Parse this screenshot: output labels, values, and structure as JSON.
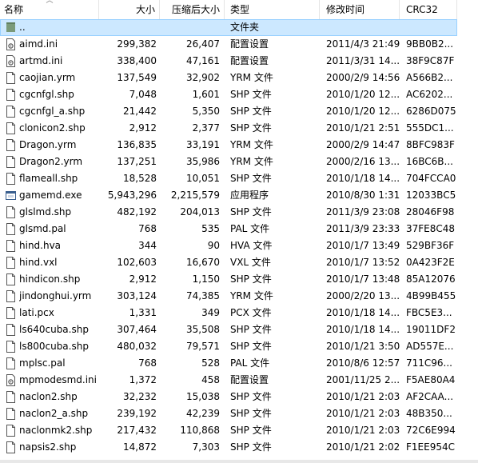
{
  "columns": {
    "name": "名称",
    "size": "大小",
    "packed": "压缩后大小",
    "type": "类型",
    "modified": "修改时间",
    "crc": "CRC32"
  },
  "selected_row": {
    "name": "..",
    "type": "文件夹"
  },
  "files": [
    {
      "name": "aimd.ini",
      "size": "299,382",
      "packed": "26,407",
      "type": "配置设置",
      "modified": "2011/4/3 21:49",
      "crc": "9BB0B2...",
      "icon": "ini-gear-icon"
    },
    {
      "name": "artmd.ini",
      "size": "338,400",
      "packed": "47,161",
      "type": "配置设置",
      "modified": "2011/3/31 14...",
      "crc": "38F9C87F",
      "icon": "ini-gear-icon"
    },
    {
      "name": "caojian.yrm",
      "size": "137,549",
      "packed": "32,902",
      "type": "YRM 文件",
      "modified": "2000/2/9 14:56",
      "crc": "A566B2...",
      "icon": "file-icon"
    },
    {
      "name": "cgcnfgl.shp",
      "size": "7,048",
      "packed": "1,601",
      "type": "SHP 文件",
      "modified": "2010/1/20 12...",
      "crc": "AC6202...",
      "icon": "file-icon"
    },
    {
      "name": "cgcnfgl_a.shp",
      "size": "21,442",
      "packed": "5,350",
      "type": "SHP 文件",
      "modified": "2010/1/20 12...",
      "crc": "6286D075",
      "icon": "file-icon"
    },
    {
      "name": "clonicon2.shp",
      "size": "2,912",
      "packed": "2,377",
      "type": "SHP 文件",
      "modified": "2010/1/21 2:51",
      "crc": "555DC1...",
      "icon": "file-icon"
    },
    {
      "name": "Dragon.yrm",
      "size": "136,835",
      "packed": "33,191",
      "type": "YRM 文件",
      "modified": "2000/2/9 14:47",
      "crc": "8BFC983F",
      "icon": "file-icon"
    },
    {
      "name": "Dragon2.yrm",
      "size": "137,251",
      "packed": "35,986",
      "type": "YRM 文件",
      "modified": "2000/2/16 13...",
      "crc": "16BC6B...",
      "icon": "file-icon"
    },
    {
      "name": "flameall.shp",
      "size": "18,528",
      "packed": "10,051",
      "type": "SHP 文件",
      "modified": "2010/1/18 14...",
      "crc": "704FCCA0",
      "icon": "file-icon"
    },
    {
      "name": "gamemd.exe",
      "size": "5,943,296",
      "packed": "2,215,579",
      "type": "应用程序",
      "modified": "2010/8/30 1:31",
      "crc": "12033BC5",
      "icon": "exe-window-icon"
    },
    {
      "name": "glslmd.shp",
      "size": "482,192",
      "packed": "204,013",
      "type": "SHP 文件",
      "modified": "2011/3/9 23:08",
      "crc": "28046F98",
      "icon": "file-icon"
    },
    {
      "name": "glsmd.pal",
      "size": "768",
      "packed": "535",
      "type": "PAL 文件",
      "modified": "2011/3/9 23:33",
      "crc": "37FE8C48",
      "icon": "file-icon"
    },
    {
      "name": "hind.hva",
      "size": "344",
      "packed": "90",
      "type": "HVA 文件",
      "modified": "2010/1/7 13:49",
      "crc": "529BF36F",
      "icon": "file-icon"
    },
    {
      "name": "hind.vxl",
      "size": "102,603",
      "packed": "16,670",
      "type": "VXL 文件",
      "modified": "2010/1/7 13:52",
      "crc": "0A423F2E",
      "icon": "file-icon"
    },
    {
      "name": "hindicon.shp",
      "size": "2,912",
      "packed": "1,150",
      "type": "SHP 文件",
      "modified": "2010/1/7 13:48",
      "crc": "85A12076",
      "icon": "file-icon"
    },
    {
      "name": "jindonghui.yrm",
      "size": "303,124",
      "packed": "74,385",
      "type": "YRM 文件",
      "modified": "2000/2/20 13...",
      "crc": "4B99B455",
      "icon": "file-icon"
    },
    {
      "name": "lati.pcx",
      "size": "1,331",
      "packed": "349",
      "type": "PCX 文件",
      "modified": "2010/1/18 14...",
      "crc": "FBC5E3...",
      "icon": "file-icon"
    },
    {
      "name": "ls640cuba.shp",
      "size": "307,464",
      "packed": "35,508",
      "type": "SHP 文件",
      "modified": "2010/1/18 14...",
      "crc": "19011DF2",
      "icon": "file-icon"
    },
    {
      "name": "ls800cuba.shp",
      "size": "480,032",
      "packed": "79,571",
      "type": "SHP 文件",
      "modified": "2010/1/21 3:50",
      "crc": "AD557E...",
      "icon": "file-icon"
    },
    {
      "name": "mplsc.pal",
      "size": "768",
      "packed": "528",
      "type": "PAL 文件",
      "modified": "2010/8/6 12:57",
      "crc": "711C96...",
      "icon": "file-icon"
    },
    {
      "name": "mpmodesmd.ini",
      "size": "1,372",
      "packed": "458",
      "type": "配置设置",
      "modified": "2001/11/25 2...",
      "crc": "F5AE80A4",
      "icon": "ini-gear-icon"
    },
    {
      "name": "naclon2.shp",
      "size": "32,232",
      "packed": "15,038",
      "type": "SHP 文件",
      "modified": "2010/1/21 2:03",
      "crc": "AF2CAA...",
      "icon": "file-icon"
    },
    {
      "name": "naclon2_a.shp",
      "size": "239,192",
      "packed": "42,239",
      "type": "SHP 文件",
      "modified": "2010/1/21 2:03",
      "crc": "48B350...",
      "icon": "file-icon"
    },
    {
      "name": "naclonmk2.shp",
      "size": "217,432",
      "packed": "110,868",
      "type": "SHP 文件",
      "modified": "2010/1/21 2:03",
      "crc": "72C6E994",
      "icon": "file-icon"
    },
    {
      "name": "napsis2.shp",
      "size": "14,872",
      "packed": "7,303",
      "type": "SHP 文件",
      "modified": "2010/1/21 2:02",
      "crc": "F1EE954C",
      "icon": "file-icon"
    }
  ],
  "colors": {
    "selection_bg": "#cce8ff",
    "selection_border": "#99d1ff",
    "folder_icon": "#7a9a7a"
  }
}
